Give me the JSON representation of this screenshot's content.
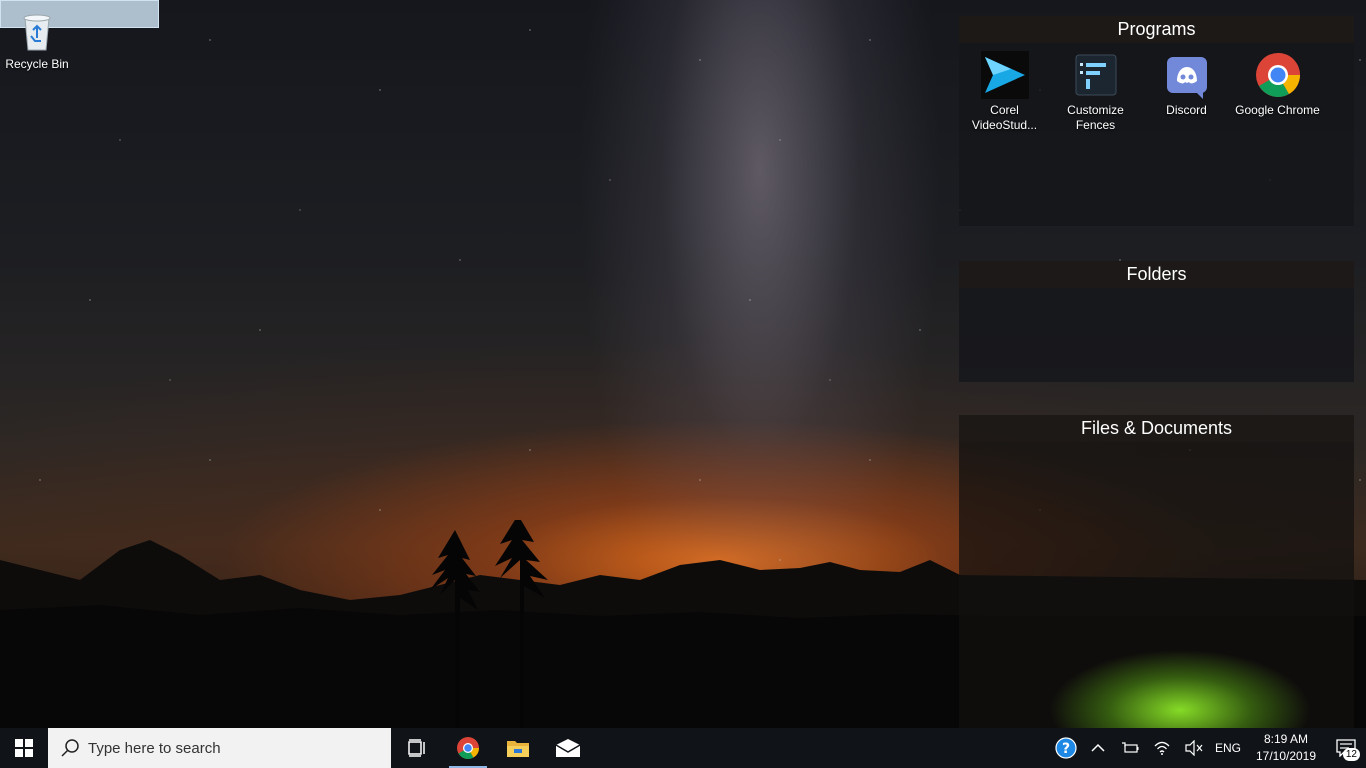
{
  "desktop": {
    "recycle_bin_label": "Recycle Bin"
  },
  "fences": [
    {
      "title": "Programs",
      "items": [
        {
          "label": "Corel VideoStud...",
          "icon": "corel-videostudio-icon"
        },
        {
          "label": "Customize Fences",
          "icon": "fences-icon"
        },
        {
          "label": "Discord",
          "icon": "discord-icon"
        },
        {
          "label": "Google Chrome",
          "icon": "chrome-icon"
        }
      ]
    },
    {
      "title": "Folders",
      "items": []
    },
    {
      "title": "Files & Documents",
      "items": []
    }
  ],
  "taskbar": {
    "search_placeholder": "Type here to search",
    "pinned": [
      {
        "name": "task-view",
        "icon": "task-view-icon"
      },
      {
        "name": "chrome",
        "icon": "chrome-icon",
        "active": true
      },
      {
        "name": "file-explorer",
        "icon": "folder-icon"
      },
      {
        "name": "mail",
        "icon": "mail-icon"
      }
    ],
    "tray": {
      "language": "ENG",
      "time": "8:19 AM",
      "date": "17/10/2019",
      "notification_count": "12"
    }
  },
  "colors": {
    "taskbar_bg": "#101418",
    "fence_bg": "#14161a",
    "accent": "#8fb7e6"
  }
}
